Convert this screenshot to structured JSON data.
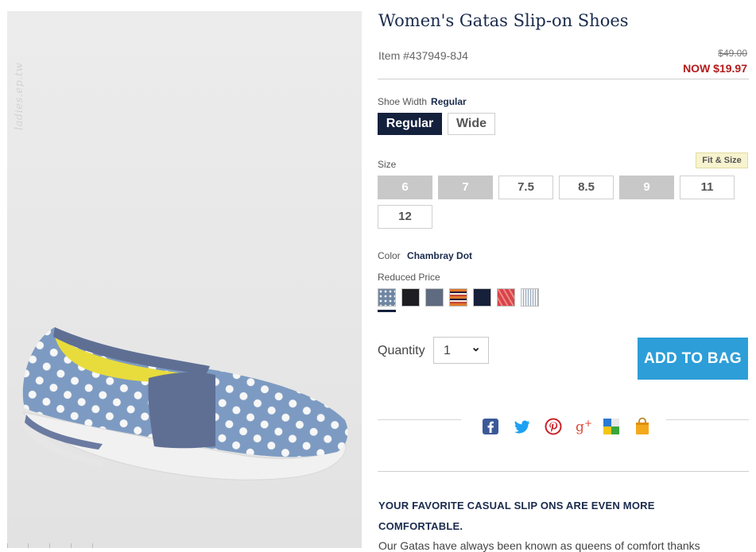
{
  "watermark": "ladies.ep.tw",
  "product": {
    "title": "Women's Gatas Slip-on Shoes",
    "item_number": "Item #437949-8J4",
    "original_price": "$49.00",
    "sale_price": "NOW $19.97"
  },
  "width": {
    "label": "Shoe Width",
    "selected": "Regular",
    "options": [
      "Regular",
      "Wide"
    ]
  },
  "size": {
    "label": "Size",
    "fit_link": "Fit & Size",
    "options": [
      {
        "label": "6",
        "available": false
      },
      {
        "label": "7",
        "available": false
      },
      {
        "label": "7.5",
        "available": true
      },
      {
        "label": "8.5",
        "available": true
      },
      {
        "label": "9",
        "available": false
      },
      {
        "label": "11",
        "available": true
      },
      {
        "label": "12",
        "available": true
      }
    ]
  },
  "color": {
    "label": "Color",
    "selected": "Chambray Dot",
    "group_label": "Reduced Price",
    "swatches": [
      {
        "name": "chambray-dot",
        "color": "#6f86a3",
        "selected": true
      },
      {
        "name": "black",
        "color": "#1e1e22"
      },
      {
        "name": "gray-blue",
        "color": "#5e6b80"
      },
      {
        "name": "multi-stripe",
        "color": "#e0782a"
      },
      {
        "name": "navy",
        "color": "#16203a"
      },
      {
        "name": "coral-pink",
        "color": "#d8434d"
      },
      {
        "name": "white-stripe",
        "color": "#c9d1da"
      }
    ]
  },
  "quantity": {
    "label": "Quantity",
    "value": "1"
  },
  "cart": {
    "add_label": "ADD TO BAG"
  },
  "share": {
    "icons": [
      "facebook-icon",
      "twitter-icon",
      "pinterest-icon",
      "google-plus-icon",
      "delicious-icon",
      "shopping-bag-icon"
    ],
    "colors": {
      "facebook": "#3b5998",
      "twitter": "#1da1f2",
      "pinterest": "#cb2027",
      "google_plus": "#dd4b39"
    }
  },
  "description": {
    "heading": "YOUR FAVORITE CASUAL SLIP ONS ARE EVEN MORE COMFORTABLE.",
    "body": "Our Gatas have always been known as queens of comfort thanks"
  },
  "colors": {
    "navy": "#14213d",
    "sale_red": "#b31b1b",
    "accent_blue": "#2d9ed8"
  }
}
